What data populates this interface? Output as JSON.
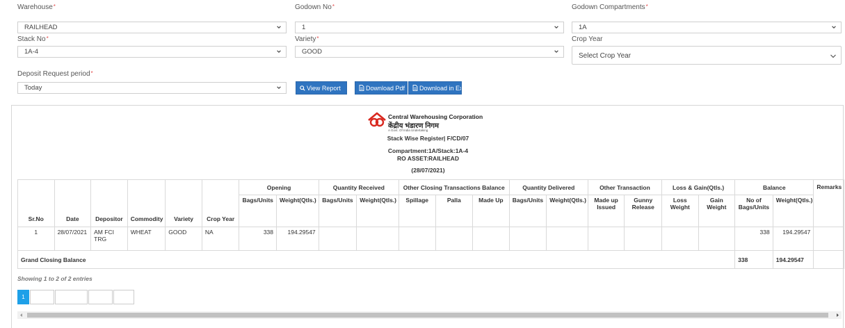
{
  "filters": {
    "warehouse": {
      "label": "Warehouse",
      "value": "RAILHEAD"
    },
    "godown_no": {
      "label": "Godown No",
      "value": "1"
    },
    "godown_compartments": {
      "label": "Godown Compartments",
      "value": "1A"
    },
    "stack_no": {
      "label": "Stack No",
      "value": "1A-4"
    },
    "variety": {
      "label": "Variety",
      "value": "GOOD"
    },
    "crop_year": {
      "label": "Crop Year",
      "placeholder": "Select Crop Year"
    },
    "deposit_period": {
      "label": "Deposit Request period",
      "value": "Today"
    }
  },
  "buttons": {
    "view_report": "View Report",
    "download_pdf": "Download Pdf",
    "download_excel": "Download in Ex"
  },
  "report": {
    "org_name_en": "Central Warehousing Corporation",
    "org_name_hi": "केंद्रीय भंडारण निगम",
    "org_subtitle": "A Govt. Of India Undertaking",
    "title": "Stack Wise Register| F/CD/07",
    "compartment_line": "Compartment:1A/Stack:1A-4",
    "asset_line": "RO ASSET:RAILHEAD",
    "date_line": "(28/07/2021)"
  },
  "table": {
    "groups": {
      "opening": "Opening",
      "qty_received": "Quantity Received",
      "other_closing": "Other Closing Transactions Balance",
      "qty_delivered": "Quantity Delivered",
      "other_transaction": "Other Transaction",
      "loss_gain": "Loss & Gain(Qtls.)",
      "balance": "Balance",
      "remarks": "Remarks"
    },
    "columns": {
      "sr_no": "Sr.No",
      "date": "Date",
      "depositor": "Depositor",
      "commodity": "Commodity",
      "variety": "Variety",
      "crop_year": "Crop Year",
      "open_bags": "Bags/Units",
      "open_weight": "Weight(Qtls.)",
      "recv_bags": "Bags/Units",
      "recv_weight": "Weight(Qtls.)",
      "spillage": "Spillage",
      "palla": "Palla",
      "made_up": "Made Up",
      "del_bags": "Bags/Units",
      "del_weight": "Weight(Qtls.)",
      "made_up_issued": "Made up Issued",
      "gunny_release": "Gunny Release",
      "loss_weight": "Loss Weight",
      "gain_weight": "Gain Weight",
      "bal_bags": "No of Bags/Units",
      "bal_weight": "Weight(Qtls.)"
    },
    "row": {
      "sr_no": "1",
      "date": "28/07/2021",
      "depositor": "AM FCI TRG",
      "commodity": "WHEAT",
      "variety": "GOOD",
      "crop_year": "NA",
      "open_bags": "338",
      "open_weight": "194.29547",
      "bal_bags": "338",
      "bal_weight": "194.29547"
    },
    "grand": {
      "label": "Grand Closing Balance",
      "bags": "338",
      "weight": "194.29547"
    }
  },
  "pagination": {
    "info": "Showing 1 to 2 of 2 entries",
    "current_page": "1"
  },
  "colors": {
    "primary_button": "#2f74c0",
    "page_active": "#1ea0e8",
    "required_mark": "#e34b4b"
  }
}
